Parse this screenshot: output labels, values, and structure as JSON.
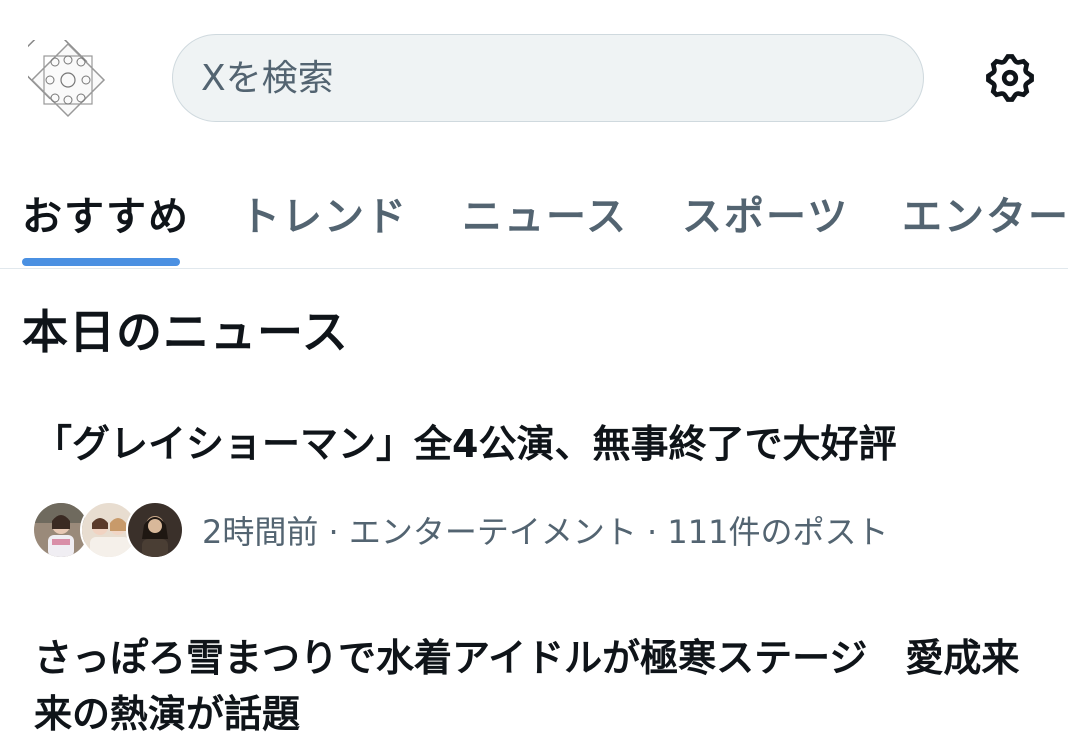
{
  "header": {
    "avatar_icon": "profile-logo-icon",
    "search_placeholder": "Xを検索",
    "settings_icon": "gear-icon"
  },
  "tabs": [
    {
      "label": "おすすめ",
      "active": true
    },
    {
      "label": "トレンド",
      "active": false
    },
    {
      "label": "ニュース",
      "active": false
    },
    {
      "label": "スポーツ",
      "active": false
    },
    {
      "label": "エンターテイメント",
      "active": false
    }
  ],
  "section": {
    "title": "本日のニュース"
  },
  "news": [
    {
      "title": "「グレイショーマン」全4公演、無事終了で大好評",
      "meta": "2時間前 · エンターテイメント · 111件のポスト"
    },
    {
      "title": "さっぽろ雪まつりで水着アイドルが極寒ステージ　愛成来来の熱演が話題"
    }
  ],
  "colors": {
    "accent": "#4a90e2",
    "text_primary": "#0f1419",
    "text_secondary": "#536471",
    "search_bg": "#eff3f4"
  }
}
